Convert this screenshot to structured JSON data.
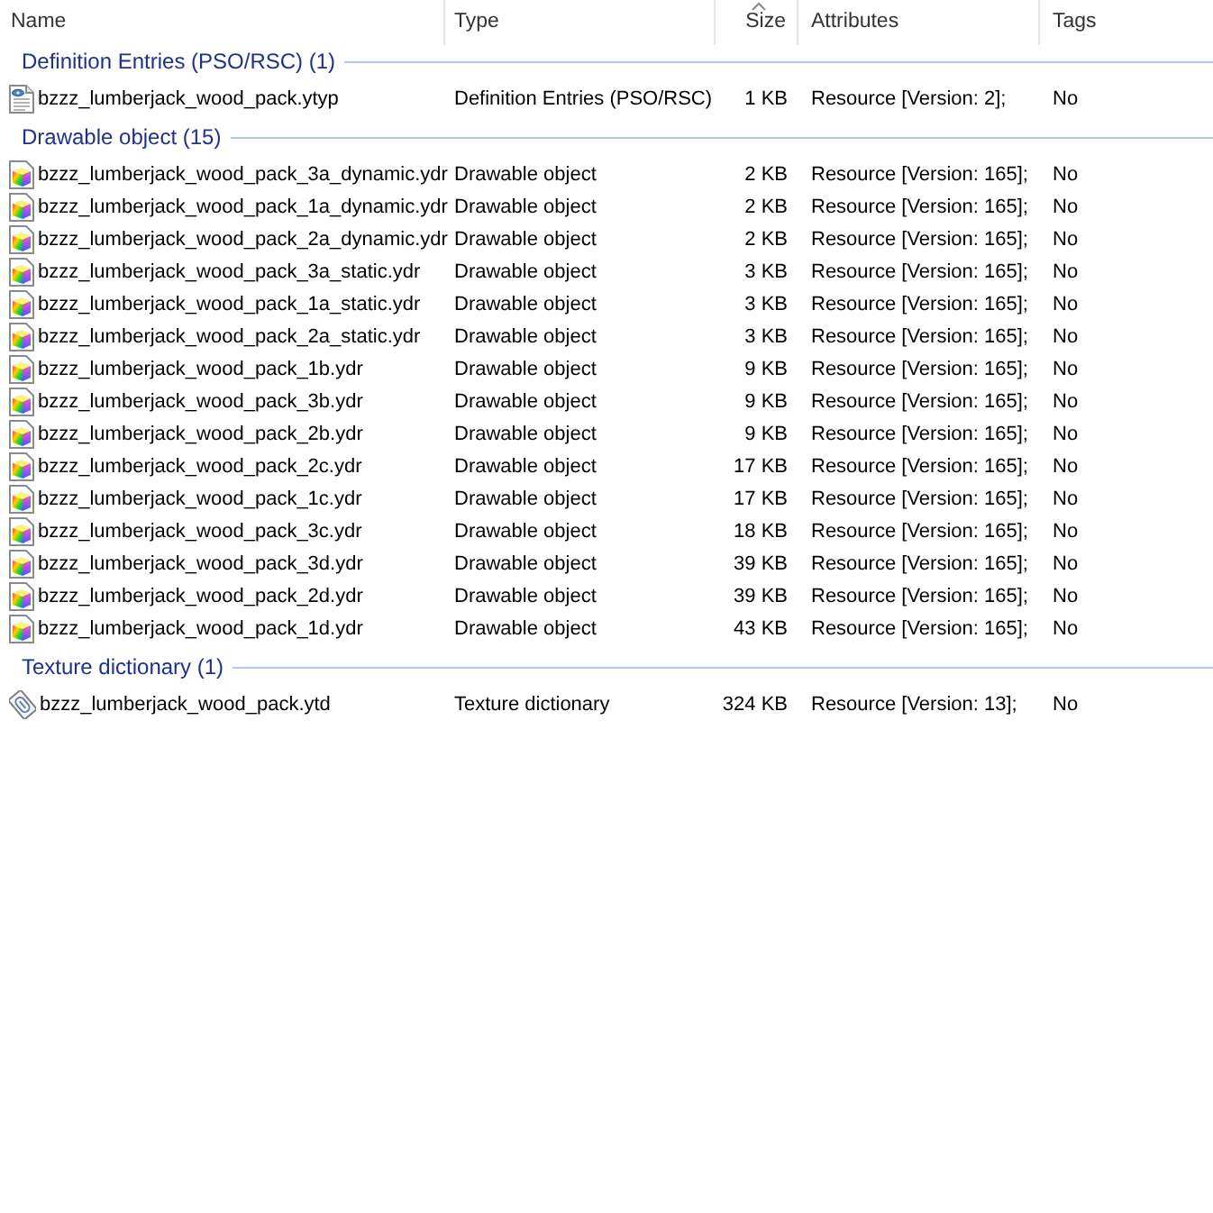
{
  "columns": [
    {
      "label": "Name",
      "sorted": false
    },
    {
      "label": "Type",
      "sorted": false
    },
    {
      "label": "Size",
      "sorted": true
    },
    {
      "label": "Attributes",
      "sorted": false
    },
    {
      "label": "Tags",
      "sorted": false
    }
  ],
  "groups": [
    {
      "title": "Definition Entries (PSO/RSC) (1)",
      "rows": [
        {
          "kind": "definition",
          "name": "bzzz_lumberjack_wood_pack.ytyp",
          "type": "Definition Entries (PSO/RSC)",
          "size": "1 KB",
          "attributes": "Resource [Version: 2];",
          "tags": "No"
        }
      ]
    },
    {
      "title": "Drawable object (15)",
      "rows": [
        {
          "kind": "drawable",
          "name": "bzzz_lumberjack_wood_pack_3a_dynamic.ydr",
          "type": "Drawable object",
          "size": "2 KB",
          "attributes": "Resource [Version: 165];",
          "tags": "No"
        },
        {
          "kind": "drawable",
          "name": "bzzz_lumberjack_wood_pack_1a_dynamic.ydr",
          "type": "Drawable object",
          "size": "2 KB",
          "attributes": "Resource [Version: 165];",
          "tags": "No"
        },
        {
          "kind": "drawable",
          "name": "bzzz_lumberjack_wood_pack_2a_dynamic.ydr",
          "type": "Drawable object",
          "size": "2 KB",
          "attributes": "Resource [Version: 165];",
          "tags": "No"
        },
        {
          "kind": "drawable",
          "name": "bzzz_lumberjack_wood_pack_3a_static.ydr",
          "type": "Drawable object",
          "size": "3 KB",
          "attributes": "Resource [Version: 165];",
          "tags": "No"
        },
        {
          "kind": "drawable",
          "name": "bzzz_lumberjack_wood_pack_1a_static.ydr",
          "type": "Drawable object",
          "size": "3 KB",
          "attributes": "Resource [Version: 165];",
          "tags": "No"
        },
        {
          "kind": "drawable",
          "name": "bzzz_lumberjack_wood_pack_2a_static.ydr",
          "type": "Drawable object",
          "size": "3 KB",
          "attributes": "Resource [Version: 165];",
          "tags": "No"
        },
        {
          "kind": "drawable",
          "name": "bzzz_lumberjack_wood_pack_1b.ydr",
          "type": "Drawable object",
          "size": "9 KB",
          "attributes": "Resource [Version: 165];",
          "tags": "No"
        },
        {
          "kind": "drawable",
          "name": "bzzz_lumberjack_wood_pack_3b.ydr",
          "type": "Drawable object",
          "size": "9 KB",
          "attributes": "Resource [Version: 165];",
          "tags": "No"
        },
        {
          "kind": "drawable",
          "name": "bzzz_lumberjack_wood_pack_2b.ydr",
          "type": "Drawable object",
          "size": "9 KB",
          "attributes": "Resource [Version: 165];",
          "tags": "No"
        },
        {
          "kind": "drawable",
          "name": "bzzz_lumberjack_wood_pack_2c.ydr",
          "type": "Drawable object",
          "size": "17 KB",
          "attributes": "Resource [Version: 165];",
          "tags": "No"
        },
        {
          "kind": "drawable",
          "name": "bzzz_lumberjack_wood_pack_1c.ydr",
          "type": "Drawable object",
          "size": "17 KB",
          "attributes": "Resource [Version: 165];",
          "tags": "No"
        },
        {
          "kind": "drawable",
          "name": "bzzz_lumberjack_wood_pack_3c.ydr",
          "type": "Drawable object",
          "size": "18 KB",
          "attributes": "Resource [Version: 165];",
          "tags": "No"
        },
        {
          "kind": "drawable",
          "name": "bzzz_lumberjack_wood_pack_3d.ydr",
          "type": "Drawable object",
          "size": "39 KB",
          "attributes": "Resource [Version: 165];",
          "tags": "No"
        },
        {
          "kind": "drawable",
          "name": "bzzz_lumberjack_wood_pack_2d.ydr",
          "type": "Drawable object",
          "size": "39 KB",
          "attributes": "Resource [Version: 165];",
          "tags": "No"
        },
        {
          "kind": "drawable",
          "name": "bzzz_lumberjack_wood_pack_1d.ydr",
          "type": "Drawable object",
          "size": "43 KB",
          "attributes": "Resource [Version: 165];",
          "tags": "No"
        }
      ]
    },
    {
      "title": "Texture dictionary (1)",
      "rows": [
        {
          "kind": "texture",
          "name": "bzzz_lumberjack_wood_pack.ytd",
          "type": "Texture dictionary",
          "size": "324 KB",
          "attributes": "Resource [Version: 13];",
          "tags": "No"
        }
      ]
    }
  ]
}
